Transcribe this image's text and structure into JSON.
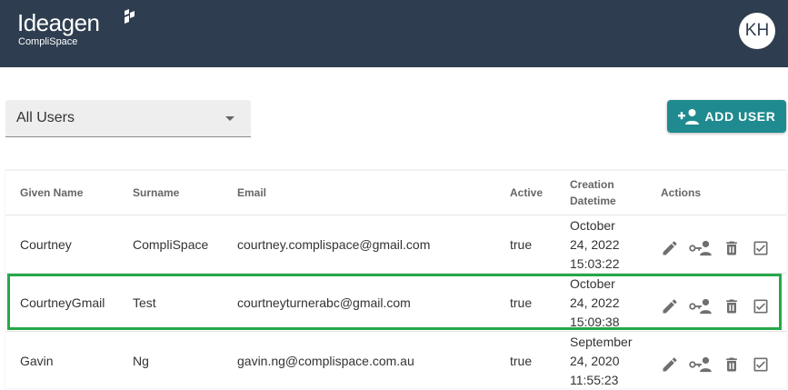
{
  "header": {
    "logo_main": "Ideagen",
    "logo_sub": "CompliSpace",
    "avatar_initials": "KH"
  },
  "filter": {
    "selected": "All Users"
  },
  "add_user_button": {
    "label": "ADD USER"
  },
  "table": {
    "columns": {
      "given_name": "Given Name",
      "surname": "Surname",
      "email": "Email",
      "active": "Active",
      "creation_1": "Creation",
      "creation_2": "Datetime",
      "actions": "Actions"
    },
    "rows": [
      {
        "given_name": "Courtney",
        "surname": "CompliSpace",
        "email": "courtney.complispace@gmail.com",
        "active": "true",
        "dt1": "October",
        "dt2": "24, 2022",
        "dt3": "15:03:22"
      },
      {
        "given_name": "CourtneyGmail",
        "surname": "Test",
        "email": "courtneyturnerabc@gmail.com",
        "active": "true",
        "dt1": "October",
        "dt2": "24, 2022",
        "dt3": "15:09:38"
      },
      {
        "given_name": "Gavin",
        "surname": "Ng",
        "email": "gavin.ng@complispace.com.au",
        "active": "true",
        "dt1": "September",
        "dt2": "24, 2020",
        "dt3": "11:55:23"
      }
    ]
  },
  "colors": {
    "topbar": "#2e3d4f",
    "accent": "#1f8a8f",
    "highlight": "#27a84a"
  }
}
